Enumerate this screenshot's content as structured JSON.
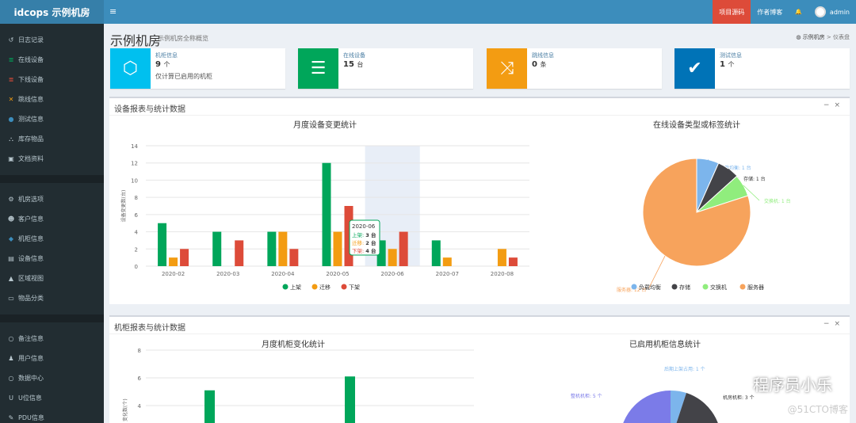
{
  "app": {
    "logo": "idcops 示例机房",
    "menu_icon": "≡"
  },
  "topbar": {
    "project_source": "项目源码",
    "author": "作者博客",
    "bell_icon": "🔔",
    "user": "admin"
  },
  "sidebar": {
    "groups": [
      [
        {
          "icon": "history-icon",
          "glyph": "↺",
          "label": "日志记录",
          "color": "#b8c7ce"
        },
        {
          "icon": "server-icon",
          "glyph": "≣",
          "label": "在线设备",
          "color": "#00a65a"
        },
        {
          "icon": "server-icon",
          "glyph": "≣",
          "label": "下线设备",
          "color": "#dd4b39"
        },
        {
          "icon": "random-icon",
          "glyph": "✕",
          "label": "跳线信息",
          "color": "#f39c12"
        },
        {
          "icon": "circle-icon",
          "glyph": "●",
          "label": "测试信息",
          "color": "#3c8dbc"
        },
        {
          "icon": "cubes-icon",
          "glyph": "⛬",
          "label": "库存物品",
          "color": "#b8c7ce"
        },
        {
          "icon": "book-icon",
          "glyph": "▣",
          "label": "文档资料",
          "color": "#b8c7ce"
        }
      ],
      [
        {
          "icon": "cogs-icon",
          "glyph": "⚙",
          "label": "机房选项",
          "color": "#b8c7ce"
        },
        {
          "icon": "users-icon",
          "glyph": "☻",
          "label": "客户信息",
          "color": "#b8c7ce"
        },
        {
          "icon": "cube-icon",
          "glyph": "◆",
          "label": "机柜信息",
          "color": "#3c8dbc"
        },
        {
          "icon": "list-icon",
          "glyph": "▤",
          "label": "设备信息",
          "color": "#b8c7ce"
        },
        {
          "icon": "building-icon",
          "glyph": "▲",
          "label": "区域视图",
          "color": "#b8c7ce"
        },
        {
          "icon": "folder-icon",
          "glyph": "▭",
          "label": "物品分类",
          "color": "#b8c7ce"
        }
      ],
      [
        {
          "icon": "circle-outline-icon",
          "glyph": "○",
          "label": "备注信息",
          "color": "#b8c7ce"
        },
        {
          "icon": "user-icon",
          "glyph": "♟",
          "label": "用户信息",
          "color": "#b8c7ce"
        },
        {
          "icon": "circle-outline-icon",
          "glyph": "○",
          "label": "数据中心",
          "color": "#b8c7ce"
        },
        {
          "icon": "magnet-icon",
          "glyph": "U",
          "label": "U位信息",
          "color": "#b8c7ce"
        },
        {
          "icon": "plug-icon",
          "glyph": "✎",
          "label": "PDU信息",
          "color": "#b8c7ce"
        }
      ]
    ]
  },
  "page": {
    "title": "示例机房",
    "subtitle": "示例机房全称概览",
    "breadcrumb_home": "示例机房",
    "breadcrumb_current": "仪表盘"
  },
  "info_boxes": [
    {
      "title": "机柜信息",
      "value": "9",
      "unit": "个",
      "desc": "仅计算已启用的机柜",
      "color": "#00c0ef",
      "icon": "cube-icon",
      "glyph": "⬡"
    },
    {
      "title": "在线设备",
      "value": "15",
      "unit": "台",
      "desc": "",
      "color": "#00a65a",
      "icon": "server-icon",
      "glyph": "☰"
    },
    {
      "title": "跳线信息",
      "value": "0",
      "unit": "条",
      "desc": "",
      "color": "#f39c12",
      "icon": "random-icon",
      "glyph": "⤨"
    },
    {
      "title": "测试信息",
      "value": "1",
      "unit": "个",
      "desc": "",
      "color": "#0073b7",
      "icon": "check-circle-icon",
      "glyph": "✔"
    }
  ],
  "panels": {
    "device": {
      "title": "设备报表与统计数据",
      "collapse": "−",
      "close": "×"
    },
    "rack": {
      "title": "机柜报表与统计数据",
      "collapse": "−",
      "close": "×"
    }
  },
  "chart_data": [
    {
      "type": "bar",
      "title": "月度设备变更统计",
      "ylabel": "设备变更数(台)",
      "categories": [
        "2020-02",
        "2020-03",
        "2020-04",
        "2020-05",
        "2020-06",
        "2020-07",
        "2020-08"
      ],
      "series": [
        {
          "name": "上架",
          "color": "#00a65a",
          "values": [
            5,
            4,
            4,
            12,
            3,
            3,
            0
          ]
        },
        {
          "name": "迁移",
          "color": "#f39c12",
          "values": [
            1,
            0,
            4,
            4,
            2,
            1,
            2
          ]
        },
        {
          "name": "下架",
          "color": "#dd4b39",
          "values": [
            2,
            3,
            2,
            7,
            4,
            0,
            1
          ]
        }
      ],
      "ylim": [
        0,
        14
      ],
      "yticks": [
        0,
        2,
        4,
        6,
        8,
        10,
        12,
        14
      ],
      "legend": "bottom",
      "highlight_category": "2020-06",
      "tooltip": {
        "title": "2020-06",
        "rows": [
          {
            "name": "上架",
            "value": "3 台"
          },
          {
            "name": "迁移",
            "value": "2 台"
          },
          {
            "name": "下架",
            "value": "4 台"
          }
        ]
      }
    },
    {
      "type": "pie",
      "title": "在线设备类型或标签统计",
      "slices": [
        {
          "name": "负载均衡",
          "value": 1,
          "label": "负载均衡: 1 台",
          "color": "#7cb5ec"
        },
        {
          "name": "存储",
          "value": 1,
          "label": "存储: 1 台",
          "color": "#434348"
        },
        {
          "name": "交换机",
          "value": 1,
          "label": "交换机: 1 台",
          "color": "#90ed7d"
        },
        {
          "name": "服务器",
          "value": 12,
          "label": "服务器: 12 台",
          "color": "#f7a35c"
        }
      ],
      "legend": "bottom"
    },
    {
      "type": "bar",
      "title": "月度机柜变化统计",
      "ylabel": "变化数(个)",
      "yticks": [
        4,
        6,
        8
      ],
      "partial": true,
      "bars": [
        {
          "color": "#00a65a",
          "value": 5.1
        },
        {
          "color": "#00a65a",
          "value": 6.1
        }
      ]
    },
    {
      "type": "pie",
      "title": "已启用机柜信息统计",
      "partial": true,
      "labels": [
        "后期上架占用: 1 个",
        "整机机柜: 5 个",
        "机房机柜: 3 个"
      ]
    }
  ],
  "watermark": {
    "main": "程序员小乐",
    "sub": "@51CTO博客"
  }
}
